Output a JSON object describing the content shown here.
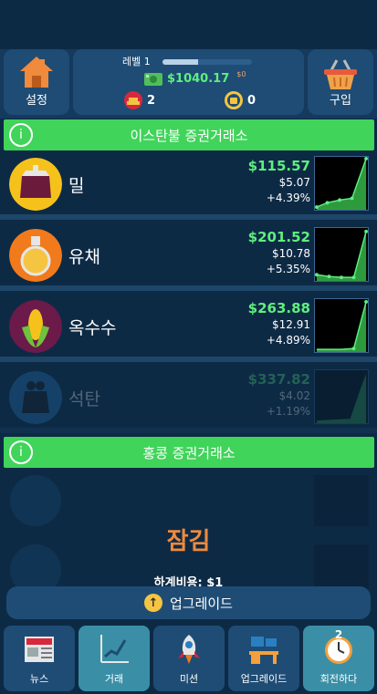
{
  "header": {
    "settings_label": "설정",
    "buy_label": "구입",
    "level_label": "레벨 1",
    "level_progress": 0.4,
    "money": "$1040.17",
    "money_small": "$0",
    "gold_count": "2",
    "coin_count": "0"
  },
  "istanbul": {
    "title": "이스탄불 증권거래소",
    "items": [
      {
        "name": "밀",
        "price": "$115.57",
        "delta": "$5.07",
        "pct": "+4.39%",
        "icon_color": "#f5c21b"
      },
      {
        "name": "유채",
        "price": "$201.52",
        "delta": "$10.78",
        "pct": "+5.35%",
        "icon_color": "#f07a1c"
      },
      {
        "name": "옥수수",
        "price": "$263.88",
        "delta": "$12.91",
        "pct": "+4.89%",
        "icon_color": "#6b1a4a"
      },
      {
        "name": "석탄",
        "price": "$337.82",
        "delta": "$4.02",
        "pct": "+1.19%",
        "icon_color": "#2a7fc2"
      }
    ]
  },
  "hongkong": {
    "title": "홍콩 증권거래소",
    "locked_label": "잠김",
    "unlock_cost": "하계비용: $1"
  },
  "upgrade_button_label": "업그레이드",
  "tabs": [
    {
      "label": "뉴스"
    },
    {
      "label": "거래"
    },
    {
      "label": "미션"
    },
    {
      "label": "업그레이드"
    },
    {
      "label": "회전하다",
      "badge": "2"
    }
  ],
  "colors": {
    "accent_green": "#40d45a",
    "price_green": "#5ef07e",
    "locked_orange": "#f08a3c",
    "panel": "#1e4c75",
    "background": "#0d2a45"
  }
}
